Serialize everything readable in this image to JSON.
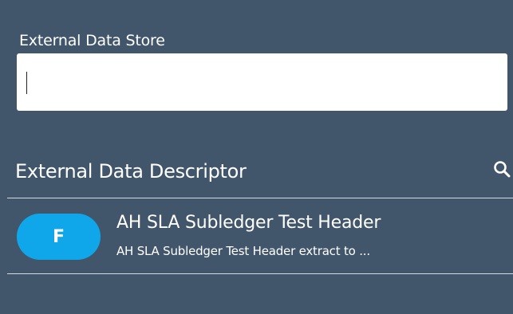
{
  "store_field": {
    "label": "External Data Store",
    "value": "",
    "placeholder": ""
  },
  "descriptor_section": {
    "title": "External Data Descriptor",
    "search_icon": "search-icon"
  },
  "items": [
    {
      "badge": "F",
      "title": "AH SLA Subledger Test Header",
      "subtitle": "AH SLA Subledger Test Header extract to ..."
    }
  ],
  "colors": {
    "background": "#41556b",
    "badge": "#10a7ea",
    "divider": "#d2dbe3",
    "input_background": "#ffffff"
  }
}
